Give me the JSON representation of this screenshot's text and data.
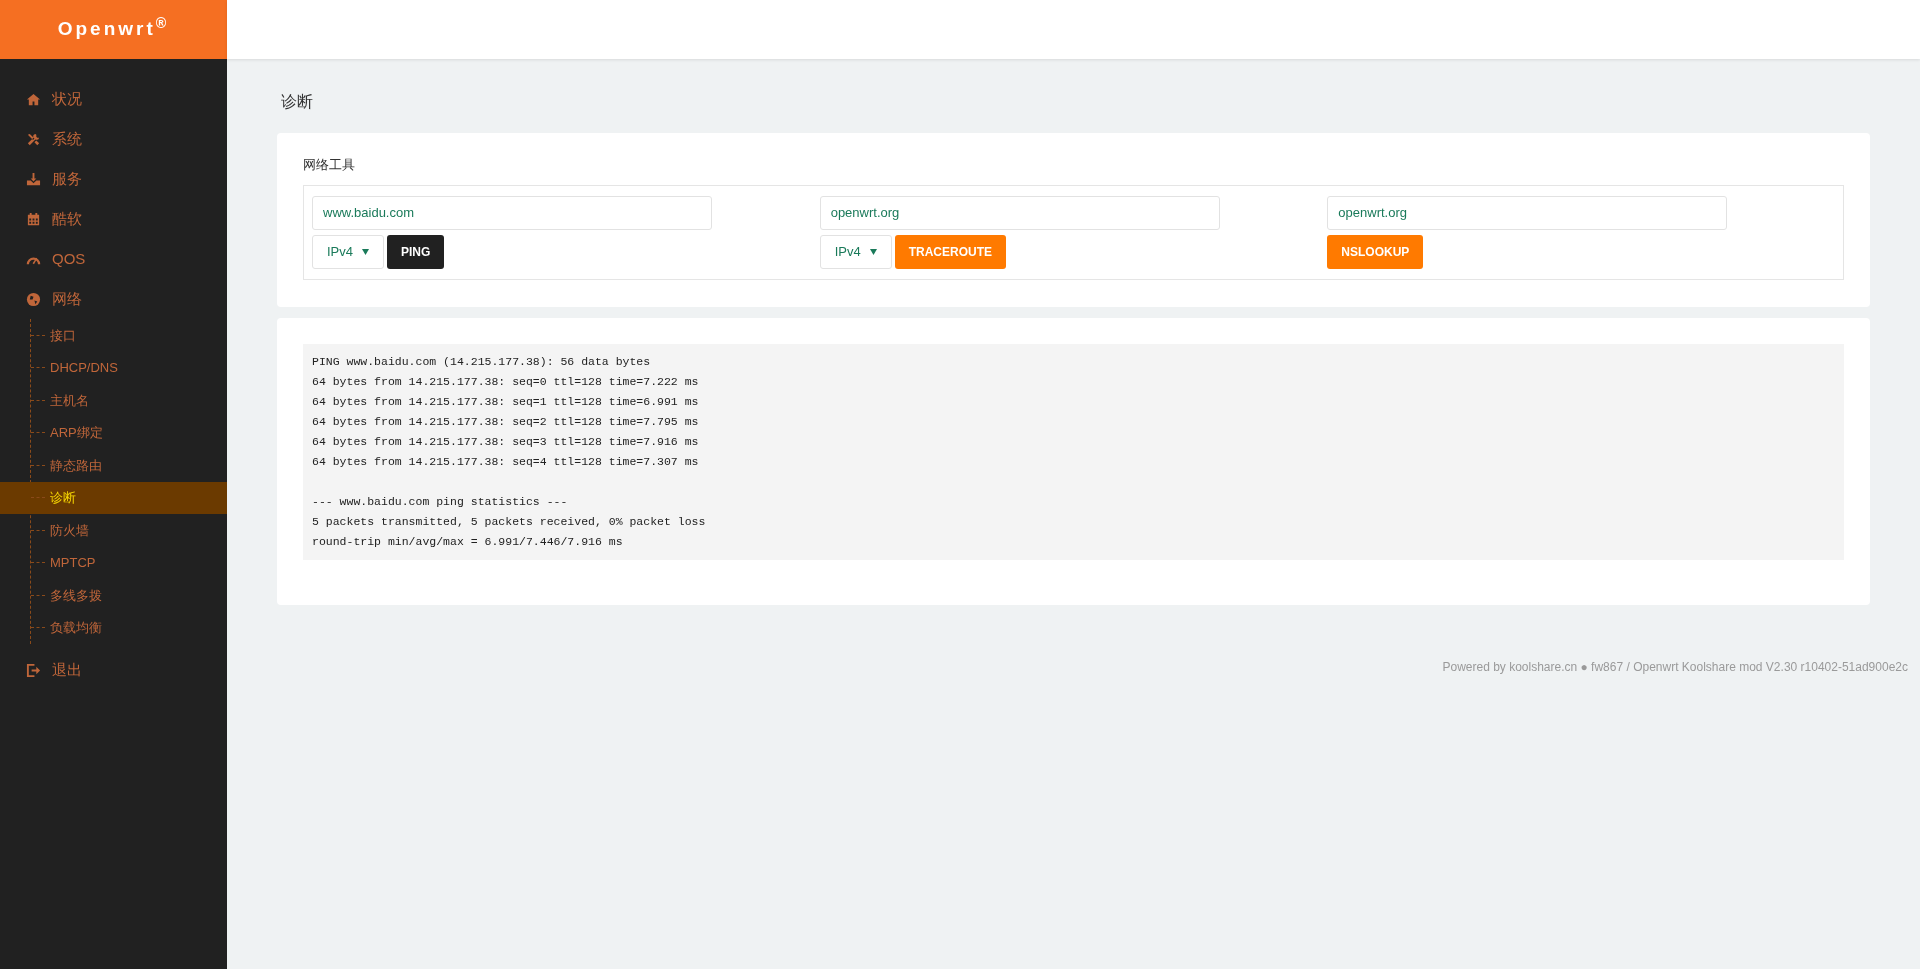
{
  "brand": "Openwrt$^{®}$",
  "menu": [
    {
      "label": "状况",
      "selected": false
    },
    {
      "label": "系统",
      "selected": false
    },
    {
      "label": "服务",
      "selected": false
    },
    {
      "label": "酷软",
      "selected": false
    },
    {
      "label": "QOS",
      "selected": false
    },
    {
      "label": "网络",
      "selected": false,
      "children": [
        {
          "label": "接口",
          "selected": false
        },
        {
          "label": "DHCP/DNS",
          "selected": false
        },
        {
          "label": "主机名",
          "selected": false
        },
        {
          "label": "ARP绑定",
          "selected": false
        },
        {
          "label": "静态路由",
          "selected": false
        },
        {
          "label": "诊断",
          "selected": true
        },
        {
          "label": "防火墙",
          "selected": false
        },
        {
          "label": "MPTCP",
          "selected": false
        },
        {
          "label": "多线多拨",
          "selected": false
        },
        {
          "label": "负载均衡",
          "selected": false
        }
      ]
    },
    {
      "label": "退出",
      "selected": false
    }
  ],
  "page_title": "诊断",
  "tools_section": {
    "title": "网络工具",
    "tools": [
      {
        "value": "www.baidu.com",
        "protocol": "IPv4",
        "button": "PING",
        "active": true
      },
      {
        "value": "openwrt.org",
        "protocol": "IPv4",
        "button": "TRACEROUTE",
        "active": false
      },
      {
        "value": "openwrt.org",
        "button": "NSLOOKUP",
        "active": false
      }
    ]
  },
  "output": [
    [
      "PING www.baidu.com (14.215.177.38): 56 data bytes",
      "64 bytes from 14.215.177.38: seq=0 ttl=128 time=7.222 ms",
      "64 bytes from 14.215.177.38: seq=1 ttl=128 time=6.991 ms",
      "64 bytes from 14.215.177.38: seq=2 ttl=128 time=7.795 ms",
      "64 bytes from 14.215.177.38: seq=3 ttl=128 time=7.916 ms",
      "64 bytes from 14.215.177.38: seq=4 ttl=128 time=7.307 ms"
    ],
    [
      "--- www.baidu.com ping statistics ---",
      "5 packets transmitted, 5 packets received, 0% packet loss",
      "round-trip min/avg/max = 6.991/7.446/7.916 ms"
    ]
  ],
  "footer": "Powered by koolshare.cn ● fw867 / Openwrt Koolshare mod V2.30 r10402-51ad900e2c"
}
